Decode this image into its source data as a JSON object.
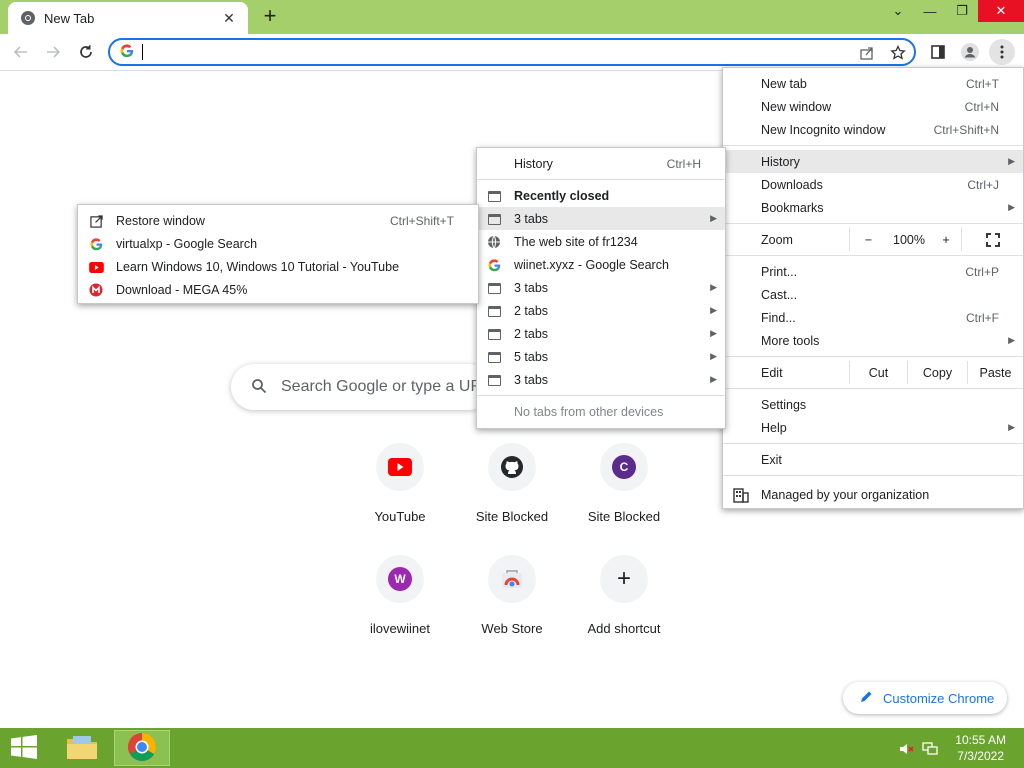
{
  "browser": {
    "tab_title": "New Tab",
    "new_tab_symbol": "+",
    "omnibox_value": ""
  },
  "ntp": {
    "search_placeholder": "Search Google or type a URL",
    "shortcuts": [
      {
        "label": "YouTube",
        "icon": "youtube-icon"
      },
      {
        "label": "Site Blocked",
        "icon": "github-icon"
      },
      {
        "label": "Site Blocked",
        "icon": "letter-c-icon",
        "letter": "C"
      },
      {
        "label": "ilovewiinet",
        "icon": "letter-w-icon",
        "letter": "W"
      },
      {
        "label": "Web Store",
        "icon": "web-store-icon"
      },
      {
        "label": "Add shortcut",
        "icon": "plus-icon",
        "symbol": "+"
      }
    ],
    "customize_label": "Customize Chrome"
  },
  "main_menu": {
    "new_tab": {
      "label": "New tab",
      "shortcut": "Ctrl+T"
    },
    "new_window": {
      "label": "New window",
      "shortcut": "Ctrl+N"
    },
    "new_incognito": {
      "label": "New Incognito window",
      "shortcut": "Ctrl+Shift+N"
    },
    "history": {
      "label": "History"
    },
    "downloads": {
      "label": "Downloads",
      "shortcut": "Ctrl+J"
    },
    "bookmarks": {
      "label": "Bookmarks"
    },
    "zoom": {
      "label": "Zoom",
      "minus": "−",
      "value": "100%",
      "plus": "+"
    },
    "print": {
      "label": "Print...",
      "shortcut": "Ctrl+P"
    },
    "cast": {
      "label": "Cast..."
    },
    "find": {
      "label": "Find...",
      "shortcut": "Ctrl+F"
    },
    "more_tools": {
      "label": "More tools"
    },
    "edit": {
      "label": "Edit",
      "cut": "Cut",
      "copy": "Copy",
      "paste": "Paste"
    },
    "settings": {
      "label": "Settings"
    },
    "help": {
      "label": "Help"
    },
    "exit": {
      "label": "Exit"
    },
    "managed": {
      "label": "Managed by your organization"
    }
  },
  "history_menu": {
    "history": {
      "label": "History",
      "shortcut": "Ctrl+H"
    },
    "recently_closed": "Recently closed",
    "items": [
      {
        "label": "3 tabs",
        "icon": "tab-group-icon",
        "submenu": true
      },
      {
        "label": "The web site of fr1234",
        "icon": "globe-icon",
        "submenu": false
      },
      {
        "label": "wiinet.xyxz - Google Search",
        "icon": "google-icon",
        "submenu": false
      },
      {
        "label": "3 tabs",
        "icon": "tab-group-icon",
        "submenu": true
      },
      {
        "label": "2 tabs",
        "icon": "tab-group-icon",
        "submenu": true
      },
      {
        "label": "2 tabs",
        "icon": "tab-group-icon",
        "submenu": true
      },
      {
        "label": "5 tabs",
        "icon": "tab-group-icon",
        "submenu": true
      },
      {
        "label": "3 tabs",
        "icon": "tab-group-icon",
        "submenu": true
      }
    ],
    "no_tabs": "No tabs from other devices"
  },
  "closed_submenu": {
    "restore": {
      "label": "Restore window",
      "shortcut": "Ctrl+Shift+T"
    },
    "items": [
      {
        "label": "virtualxp - Google Search",
        "icon": "google-icon"
      },
      {
        "label": "Learn Windows 10, Windows 10 Tutorial - YouTube",
        "icon": "youtube-icon"
      },
      {
        "label": "Download - MEGA 45%",
        "icon": "mega-icon"
      }
    ]
  },
  "taskbar": {
    "time": "10:55 AM",
    "date": "7/3/2022"
  },
  "colors": {
    "frame": "#a4cf6a",
    "taskbar": "#6aa42f",
    "accent": "#1a73e8"
  }
}
